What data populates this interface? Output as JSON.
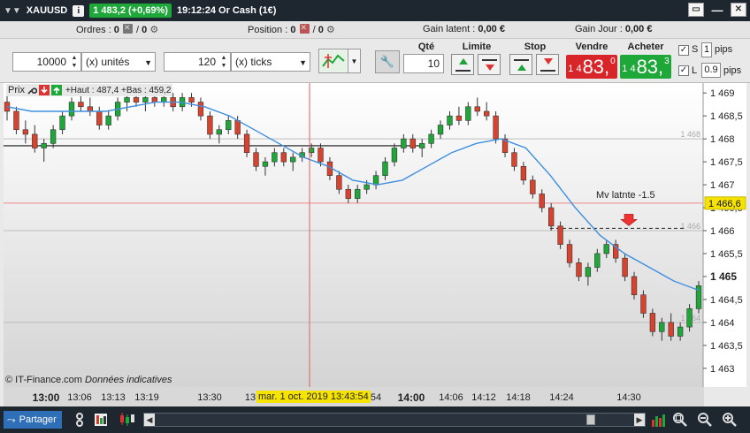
{
  "titlebar": {
    "instrument": "XAUUSD",
    "info_glyph": "i",
    "price_change": "1 483,2 (+0,69%)",
    "time_desc": "19:12:24 Or Cash (1€)"
  },
  "info": {
    "orders_label": "Ordres :",
    "orders_a": "0",
    "orders_sep": "/",
    "orders_b": "0",
    "position_label": "Position :",
    "position_a": "0",
    "position_sep": "/",
    "position_b": "0",
    "gain_latent_label": "Gain latent :",
    "gain_latent_value": "0,00 €",
    "gain_jour_label": "Gain Jour :",
    "gain_jour_value": "0,00 €"
  },
  "order": {
    "quantity_value": "10000",
    "quantity_unit": "(x) unités",
    "ticks_value": "120",
    "ticks_unit": "(x) ticks",
    "qte_label": "Qté",
    "qte_value": "10",
    "limite_label": "Limite",
    "stop_label": "Stop",
    "vendre_label": "Vendre",
    "vendre_small": "1 4",
    "vendre_big": "83,",
    "vendre_sup": "0",
    "acheter_label": "Acheter",
    "acheter_small": "1 4",
    "acheter_big": "83,",
    "acheter_sup": "3",
    "s_label": "S",
    "s_value": "1",
    "l_label": "L",
    "l_value": "0.9",
    "pips_label": "pips",
    "pips_label2": "pips"
  },
  "chart_panel": {
    "prix_label": "Prix",
    "legend_text": "+Haut : 487,4 +Bas : 459,2",
    "annotation": "Mv latnte -1.5",
    "copyright": "© IT-Finance.com",
    "copyright_note": "Données indicatives",
    "crosshair_time": "mar. 1 oct. 2019 13:43:54",
    "current_price_label": "1 466,6",
    "last_price_label": "1 465",
    "ghost_labels": [
      "1 468",
      "1 466",
      "1 464"
    ]
  },
  "chart_data": {
    "type": "candlestick",
    "y_ticks": [
      "1 469",
      "1 468,5",
      "1 468",
      "1 467,5",
      "1 467",
      "1 466,5",
      "1 466",
      "1 465,5",
      "1 465",
      "1 464,5",
      "1 464",
      "1 463,5",
      "1 463"
    ],
    "ylim": [
      1462.9,
      1469.1
    ],
    "x_ticks": [
      "13:00",
      "13:06",
      "13:13",
      "13:19",
      "13:30",
      "13",
      "54",
      "14:00",
      "14:06",
      "14:12",
      "14:18",
      "14:24",
      "14:30"
    ],
    "candles_ohlc": [
      [
        1468.8,
        1469.0,
        1468.4,
        1468.6
      ],
      [
        1468.6,
        1468.7,
        1468.1,
        1468.2
      ],
      [
        1468.2,
        1468.4,
        1467.9,
        1468.1
      ],
      [
        1468.1,
        1468.3,
        1467.7,
        1467.8
      ],
      [
        1467.8,
        1468.0,
        1467.5,
        1467.9
      ],
      [
        1467.9,
        1468.3,
        1467.8,
        1468.2
      ],
      [
        1468.2,
        1468.6,
        1468.1,
        1468.5
      ],
      [
        1468.5,
        1468.9,
        1468.4,
        1468.8
      ],
      [
        1468.8,
        1469.0,
        1468.6,
        1468.7
      ],
      [
        1468.7,
        1468.9,
        1468.5,
        1468.6
      ],
      [
        1468.6,
        1468.7,
        1468.2,
        1468.3
      ],
      [
        1468.3,
        1468.6,
        1468.2,
        1468.5
      ],
      [
        1468.5,
        1468.9,
        1468.4,
        1468.8
      ],
      [
        1468.8,
        1469.0,
        1468.6,
        1468.9
      ],
      [
        1468.9,
        1469.0,
        1468.7,
        1468.8
      ],
      [
        1468.8,
        1469.0,
        1468.6,
        1468.9
      ],
      [
        1468.9,
        1469.0,
        1468.7,
        1468.8
      ],
      [
        1468.8,
        1469.0,
        1468.7,
        1468.9
      ],
      [
        1468.9,
        1469.0,
        1468.6,
        1468.7
      ],
      [
        1468.7,
        1469.0,
        1468.6,
        1468.9
      ],
      [
        1468.9,
        1469.0,
        1468.7,
        1468.8
      ],
      [
        1468.8,
        1468.9,
        1468.4,
        1468.5
      ],
      [
        1468.5,
        1468.6,
        1468.0,
        1468.1
      ],
      [
        1468.1,
        1468.3,
        1467.9,
        1468.2
      ],
      [
        1468.2,
        1468.5,
        1468.1,
        1468.4
      ],
      [
        1468.4,
        1468.5,
        1468.0,
        1468.1
      ],
      [
        1468.1,
        1468.2,
        1467.6,
        1467.7
      ],
      [
        1467.7,
        1467.8,
        1467.3,
        1467.4
      ],
      [
        1467.4,
        1467.6,
        1467.2,
        1467.5
      ],
      [
        1467.5,
        1467.8,
        1467.4,
        1467.7
      ],
      [
        1467.7,
        1467.8,
        1467.4,
        1467.5
      ],
      [
        1467.5,
        1467.7,
        1467.3,
        1467.6
      ],
      [
        1467.6,
        1467.8,
        1467.5,
        1467.7
      ],
      [
        1467.7,
        1467.9,
        1467.6,
        1467.8
      ],
      [
        1467.8,
        1467.9,
        1467.4,
        1467.5
      ],
      [
        1467.5,
        1467.6,
        1467.1,
        1467.2
      ],
      [
        1467.2,
        1467.3,
        1466.8,
        1466.9
      ],
      [
        1466.9,
        1467.0,
        1466.6,
        1466.7
      ],
      [
        1466.7,
        1467.0,
        1466.6,
        1466.9
      ],
      [
        1466.9,
        1467.1,
        1466.8,
        1467.0
      ],
      [
        1467.0,
        1467.3,
        1466.9,
        1467.2
      ],
      [
        1467.2,
        1467.6,
        1467.1,
        1467.5
      ],
      [
        1467.5,
        1467.9,
        1467.4,
        1467.8
      ],
      [
        1467.8,
        1468.1,
        1467.7,
        1468.0
      ],
      [
        1468.0,
        1468.1,
        1467.7,
        1467.8
      ],
      [
        1467.8,
        1468.0,
        1467.6,
        1467.9
      ],
      [
        1467.9,
        1468.2,
        1467.8,
        1468.1
      ],
      [
        1468.1,
        1468.4,
        1468.0,
        1468.3
      ],
      [
        1468.3,
        1468.6,
        1468.2,
        1468.5
      ],
      [
        1468.5,
        1468.7,
        1468.3,
        1468.4
      ],
      [
        1468.4,
        1468.8,
        1468.3,
        1468.7
      ],
      [
        1468.7,
        1468.9,
        1468.5,
        1468.6
      ],
      [
        1468.6,
        1468.8,
        1468.4,
        1468.5
      ],
      [
        1468.5,
        1468.6,
        1467.9,
        1468.0
      ],
      [
        1468.0,
        1468.1,
        1467.6,
        1467.7
      ],
      [
        1467.7,
        1467.8,
        1467.3,
        1467.4
      ],
      [
        1467.4,
        1467.5,
        1467.0,
        1467.1
      ],
      [
        1467.1,
        1467.2,
        1466.7,
        1466.8
      ],
      [
        1466.8,
        1466.9,
        1466.4,
        1466.5
      ],
      [
        1466.5,
        1466.6,
        1466.0,
        1466.1
      ],
      [
        1466.1,
        1466.2,
        1465.6,
        1465.7
      ],
      [
        1465.7,
        1465.8,
        1465.2,
        1465.3
      ],
      [
        1465.3,
        1465.4,
        1464.9,
        1465.0
      ],
      [
        1465.0,
        1465.3,
        1464.8,
        1465.2
      ],
      [
        1465.2,
        1465.6,
        1465.1,
        1465.5
      ],
      [
        1465.5,
        1465.8,
        1465.4,
        1465.7
      ],
      [
        1465.7,
        1465.8,
        1465.3,
        1465.4
      ],
      [
        1465.4,
        1465.5,
        1464.9,
        1465.0
      ],
      [
        1465.0,
        1465.1,
        1464.5,
        1464.6
      ],
      [
        1464.6,
        1464.7,
        1464.1,
        1464.2
      ],
      [
        1464.2,
        1464.3,
        1463.7,
        1463.8
      ],
      [
        1463.8,
        1464.1,
        1463.6,
        1464.0
      ],
      [
        1464.0,
        1464.2,
        1463.6,
        1463.7
      ],
      [
        1463.7,
        1464.0,
        1463.6,
        1463.9
      ],
      [
        1463.9,
        1464.4,
        1463.8,
        1464.3
      ],
      [
        1464.3,
        1464.9,
        1464.2,
        1464.8
      ]
    ],
    "moving_average": [
      1468.7,
      1468.6,
      1468.6,
      1468.6,
      1468.6,
      1468.7,
      1468.8,
      1468.8,
      1468.7,
      1468.5,
      1468.2,
      1467.9,
      1467.6,
      1467.4,
      1467.1,
      1467.0,
      1467.1,
      1467.4,
      1467.7,
      1467.9,
      1468.0,
      1467.8,
      1467.2,
      1466.5,
      1465.9,
      1465.5,
      1465.2,
      1464.9,
      1464.7
    ],
    "horizontal_lines": [
      {
        "value": 1467.85,
        "style": "solid-black"
      },
      {
        "value": 1466.6,
        "style": "solid-red"
      },
      {
        "value": 1466.05,
        "style": "dashed-black"
      },
      {
        "value": 1468.0,
        "style": "grid"
      },
      {
        "value": 1466.0,
        "style": "grid"
      },
      {
        "value": 1464.0,
        "style": "grid"
      }
    ],
    "colors": {
      "up": "#1fa83a",
      "down": "#d8432e",
      "ma": "#3d8fe0",
      "crosshair": "#e06060",
      "background_top": "#ffffff",
      "background_bottom": "#d8d8d8"
    }
  },
  "bottombar": {
    "share_label": "Partager"
  }
}
